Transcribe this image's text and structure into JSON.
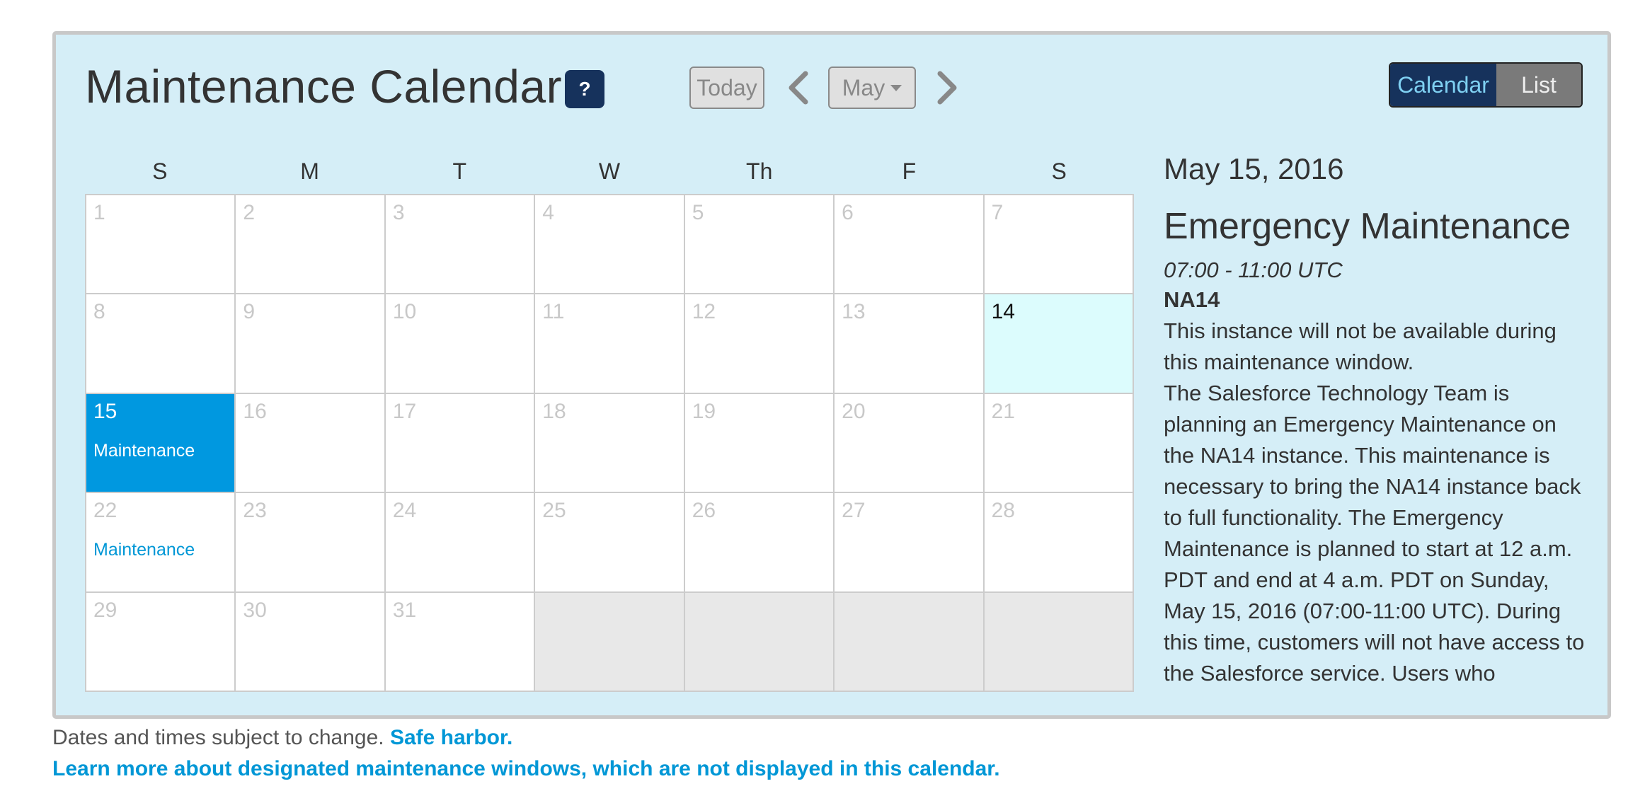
{
  "header": {
    "title": "Maintenance Calendar",
    "help_label": "?",
    "today_label": "Today",
    "month_label": "May",
    "view_calendar_label": "Calendar",
    "view_list_label": "List"
  },
  "days_of_week": [
    "S",
    "M",
    "T",
    "W",
    "Th",
    "F",
    "S"
  ],
  "calendar": {
    "cells": [
      {
        "day": "1"
      },
      {
        "day": "2"
      },
      {
        "day": "3"
      },
      {
        "day": "4"
      },
      {
        "day": "5"
      },
      {
        "day": "6"
      },
      {
        "day": "7"
      },
      {
        "day": "8"
      },
      {
        "day": "9"
      },
      {
        "day": "10"
      },
      {
        "day": "11"
      },
      {
        "day": "12"
      },
      {
        "day": "13"
      },
      {
        "day": "14",
        "state": "today"
      },
      {
        "day": "15",
        "state": "selected",
        "event": "Maintenance"
      },
      {
        "day": "16"
      },
      {
        "day": "17"
      },
      {
        "day": "18"
      },
      {
        "day": "19"
      },
      {
        "day": "20"
      },
      {
        "day": "21"
      },
      {
        "day": "22",
        "event": "Maintenance"
      },
      {
        "day": "23"
      },
      {
        "day": "24"
      },
      {
        "day": "25"
      },
      {
        "day": "26"
      },
      {
        "day": "27"
      },
      {
        "day": "28"
      },
      {
        "day": "29"
      },
      {
        "day": "30"
      },
      {
        "day": "31"
      },
      {
        "day": ""
      },
      {
        "day": ""
      },
      {
        "day": ""
      },
      {
        "day": ""
      }
    ]
  },
  "detail": {
    "date": "May 15, 2016",
    "title": "Emergency Maintenance",
    "time": "07:00 - 11:00 UTC",
    "instance": "NA14",
    "availability": "This instance will not be available during this maintenance window.",
    "description": "The Salesforce Technology Team is planning an Emergency Maintenance on the NA14 instance. This maintenance is necessary to bring the NA14 instance back to full functionality. The Emergency Maintenance is planned to start at 12 a.m. PDT and end at 4 a.m. PDT on Sunday, May 15, 2016 (07:00-11:00 UTC). During this time, customers will not have access to the Salesforce service. Users who"
  },
  "footer": {
    "disclaimer": "Dates and times subject to change.",
    "safe_harbor_link": "Safe harbor.",
    "windows_link": "Learn more about designated maintenance windows, which are not displayed in this calendar."
  },
  "colors": {
    "panel_bg": "#d5eef7",
    "selected_day": "#0098e0",
    "today_day": "#dcfcfd",
    "accent_link": "#0097d6",
    "dark_navy": "#16325c"
  },
  "icons": {
    "prev": "chevron-left-icon",
    "next": "chevron-right-icon",
    "dropdown": "caret-down-icon",
    "help": "question-icon"
  }
}
